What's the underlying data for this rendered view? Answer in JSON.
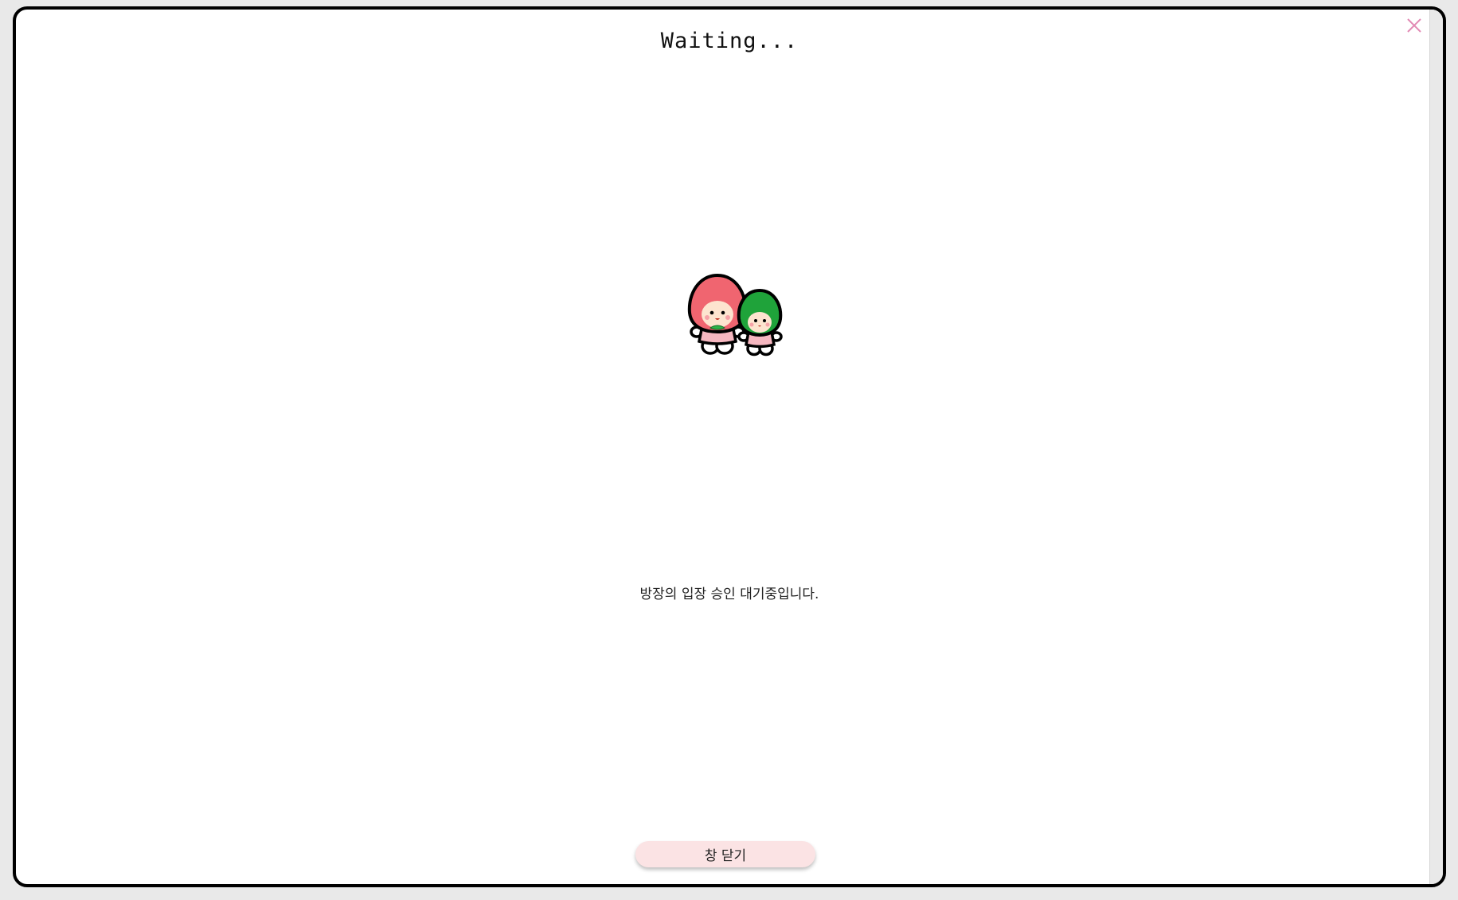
{
  "dialog": {
    "title": "Waiting...",
    "message": "방장의 입장 승인 대기중입니다.",
    "close_button_label": "창 닫기",
    "close_icon": "close-icon",
    "mascot_image": "strawberry-mascots"
  },
  "colors": {
    "border": "#000000",
    "close_icon": "#e28ab4",
    "button_bg": "#fbe3e4",
    "mascot_red": "#f06570",
    "mascot_green": "#1fa33a"
  }
}
